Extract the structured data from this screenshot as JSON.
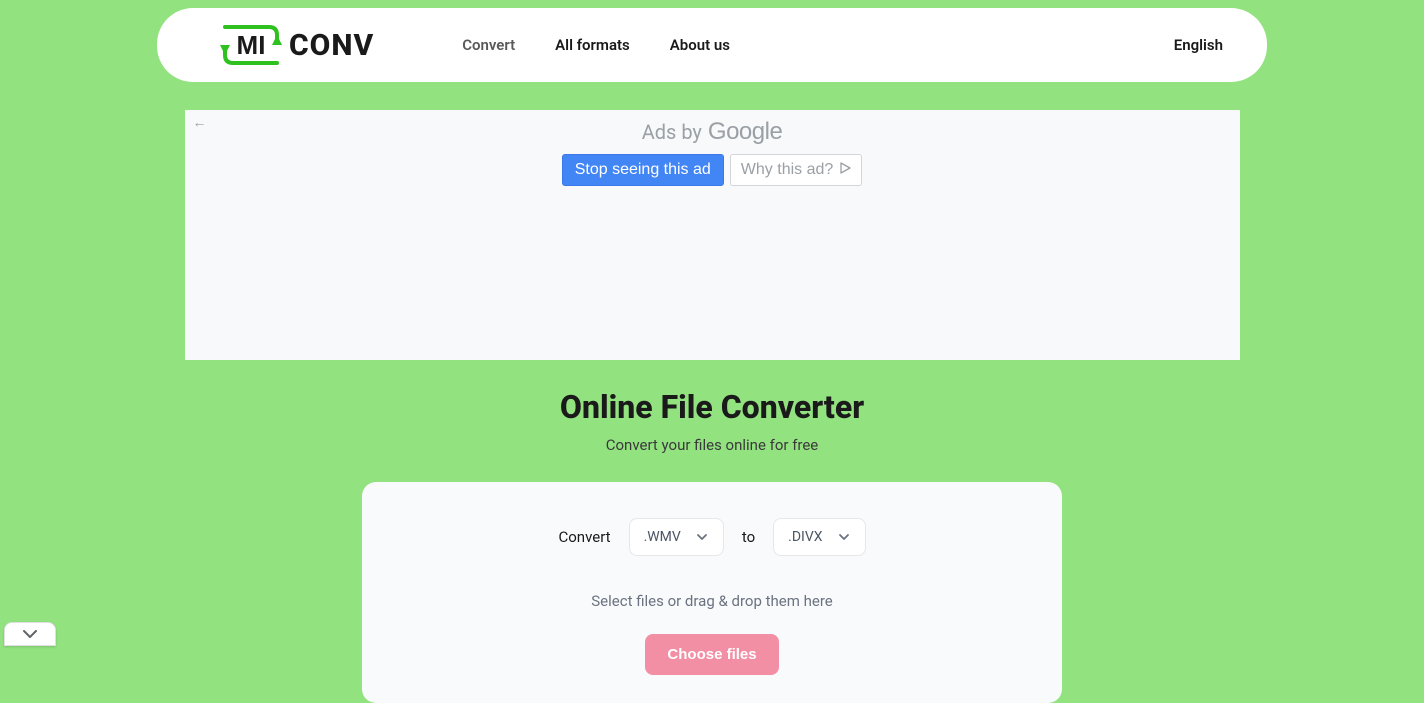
{
  "logo": {
    "part1": "MI",
    "part2": "CONV"
  },
  "nav": {
    "convert": "Convert",
    "all_formats": "All formats",
    "about": "About us"
  },
  "language": "English",
  "ad": {
    "label": "Ads by",
    "brand": "Google",
    "stop": "Stop seeing this ad",
    "why": "Why this ad?"
  },
  "headline": {
    "title": "Online File Converter",
    "subtitle": "Convert your files online for free"
  },
  "converter": {
    "convert_label": "Convert",
    "from": ".WMV",
    "to_label": "to",
    "to": ".DIVX",
    "drop_text": "Select files or drag & drop them here",
    "choose_button": "Choose files"
  }
}
